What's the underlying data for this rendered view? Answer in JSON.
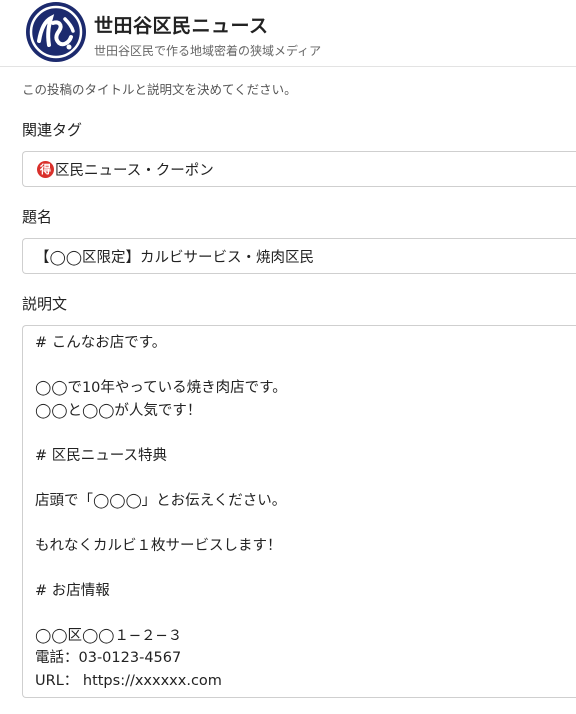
{
  "site": {
    "title": "世田谷区民ニュース",
    "tagline": "世田谷区民で作る地域密着の狭域メディア"
  },
  "instruction": "この投稿のタイトルと説明文を決めてください。",
  "fields": {
    "tags": {
      "label": "関連タグ",
      "badge": "得",
      "value": "区民ニュース・クーポン"
    },
    "title": {
      "label": "題名",
      "value": "【◯◯区限定】カルビサービス・焼肉区民"
    },
    "description": {
      "label": "説明文",
      "lines": [
        "# こんなお店です。",
        "",
        "◯◯で10年やっている焼き肉店です。",
        "◯◯と◯◯が人気です！",
        "",
        "# 区民ニュース特典",
        "",
        "店頭で「◯◯◯」とお伝えください。",
        "",
        "もれなくカルビ１枚サービスします！",
        "",
        "# お店情報",
        "",
        "◯◯区◯◯１−２−３",
        "電話：03-0123-4567",
        "URL： https://xxxxxx.com"
      ]
    }
  },
  "colors": {
    "logo_navy": "#1c2a6e",
    "badge_red": "#d9302b",
    "border": "#cfcfcf"
  }
}
